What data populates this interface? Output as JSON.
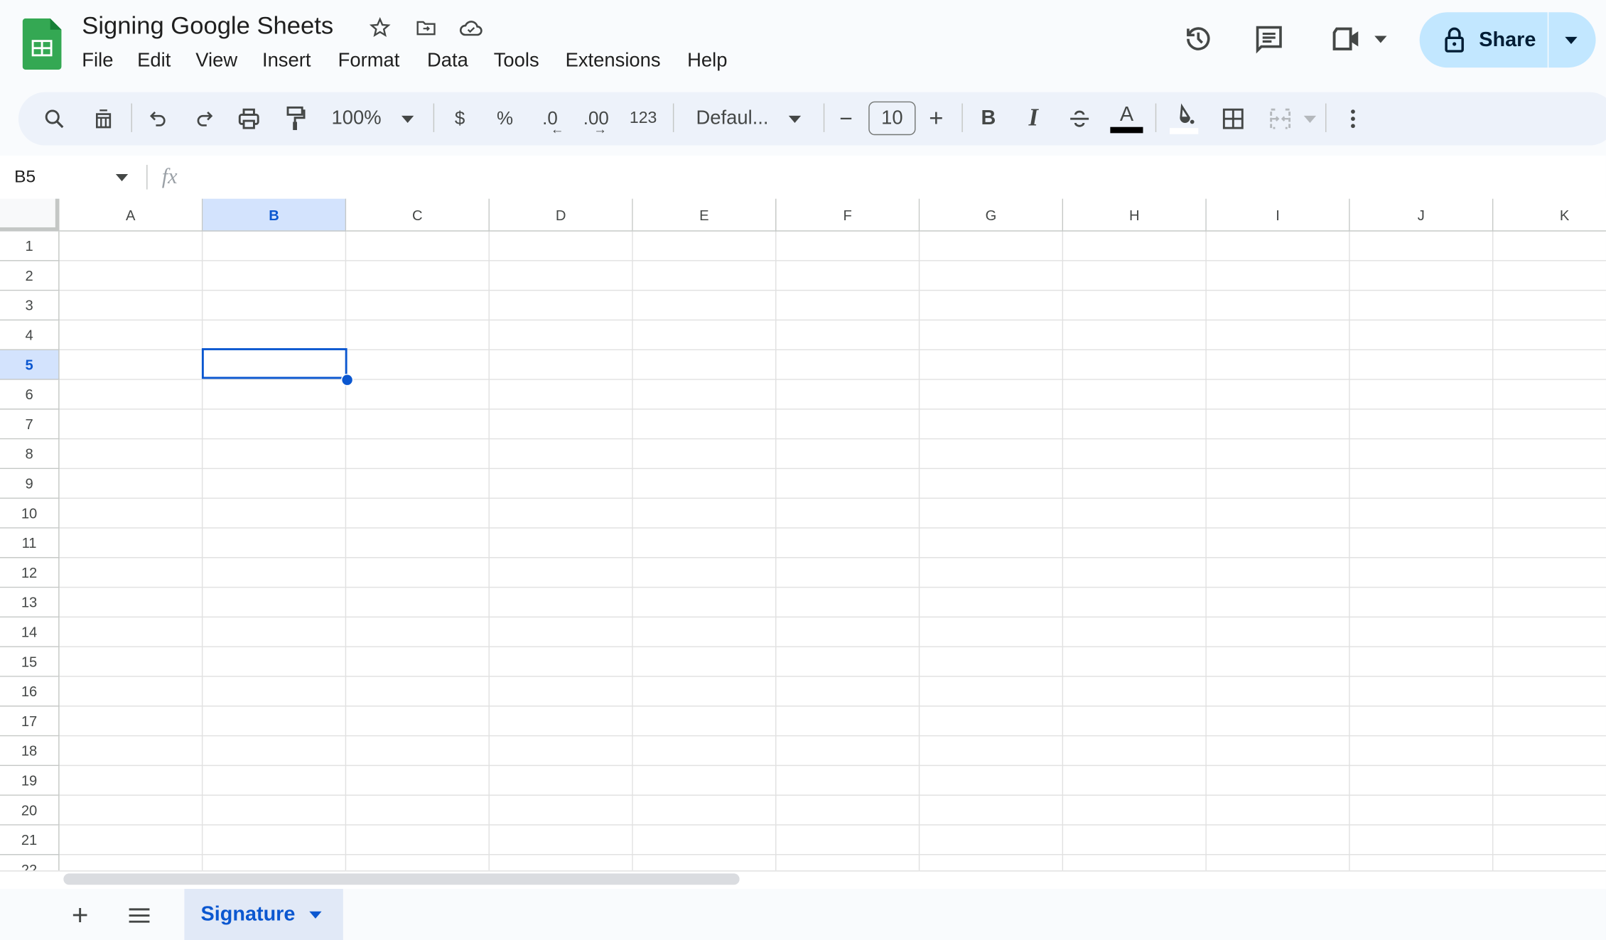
{
  "app": {
    "title": "Signing Google Sheets",
    "brand_color": "#34a853"
  },
  "menu": [
    "File",
    "Edit",
    "View",
    "Insert",
    "Format",
    "Data",
    "Tools",
    "Extensions",
    "Help"
  ],
  "header": {
    "share_label": "Share",
    "share_bg": "#c2e7ff"
  },
  "toolbar": {
    "zoom": "100%",
    "currency": "$",
    "percent": "%",
    "dec_decrease": ".0",
    "dec_increase": ".00",
    "format_123": "123",
    "font": "Defaul...",
    "font_size": "10",
    "minus": "−",
    "plus": "+",
    "bold": "B",
    "italic": "I",
    "text_color": "A"
  },
  "formula_bar": {
    "cell_ref": "B5",
    "fx": "fx",
    "value": ""
  },
  "grid": {
    "columns": [
      "A",
      "B",
      "C",
      "D",
      "E",
      "F",
      "G",
      "H",
      "I",
      "J",
      "K"
    ],
    "rows": [
      "1",
      "2",
      "3",
      "4",
      "5",
      "6",
      "7",
      "8",
      "9",
      "10",
      "11",
      "12",
      "13",
      "14",
      "15",
      "16",
      "17",
      "18",
      "19",
      "20",
      "21",
      "22"
    ],
    "selected_cell": "B5",
    "selection_color": "#0b57d0"
  },
  "sheets": {
    "tabs": [
      {
        "label": "Signature",
        "active": true
      }
    ],
    "add_label": "+"
  }
}
